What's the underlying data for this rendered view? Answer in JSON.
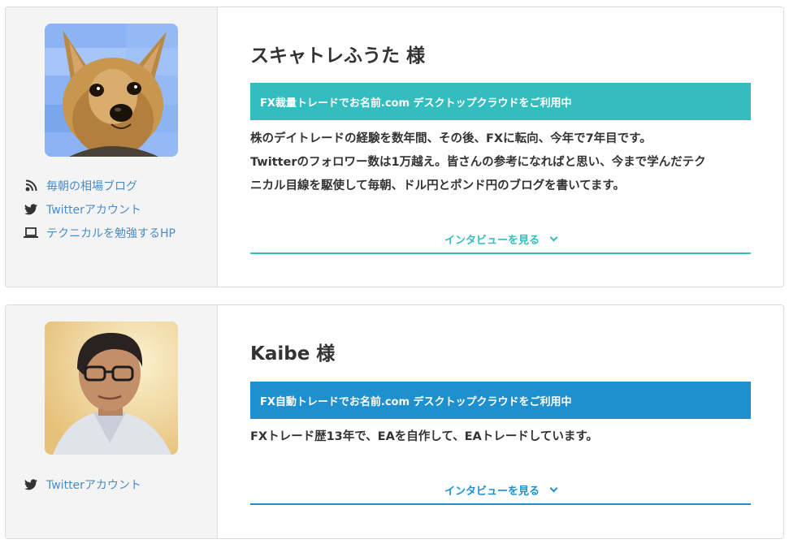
{
  "colors": {
    "teal": "#33bdbe",
    "blue": "#1e90d0",
    "link": "#4a8bc4"
  },
  "profiles": [
    {
      "name": "スキャトレふうた 様",
      "avatar": "dog-photo",
      "banner": "FX裁量トレードでお名前.com デスクトップクラウドをご利用中",
      "bio": [
        "株のデイトレードの経験を数年間、その後、FXに転向、今年で7年目です。",
        "Twitterのフォロワー数は1万越え。皆さんの参考になればと思い、今まで学んだテク",
        "ニカル目線を駆使して毎朝、ドル円とポンド円のブログを書いてます。"
      ],
      "links": [
        {
          "icon": "blog-icon",
          "label": "毎朝の相場ブログ"
        },
        {
          "icon": "twitter-icon",
          "label": "Twitterアカウント"
        },
        {
          "icon": "laptop-icon",
          "label": "テクニカルを勉強するHP"
        }
      ],
      "view_label": "インタビューを見る"
    },
    {
      "name": "Kaibe 様",
      "avatar": "man-photo",
      "banner": "FX自動トレードでお名前.com デスクトップクラウドをご利用中",
      "bio": [
        "FXトレード歴13年で、EAを自作して、EAトレードしています。"
      ],
      "links": [
        {
          "icon": "twitter-icon",
          "label": "Twitterアカウント"
        }
      ],
      "view_label": "インタビューを見る"
    }
  ]
}
